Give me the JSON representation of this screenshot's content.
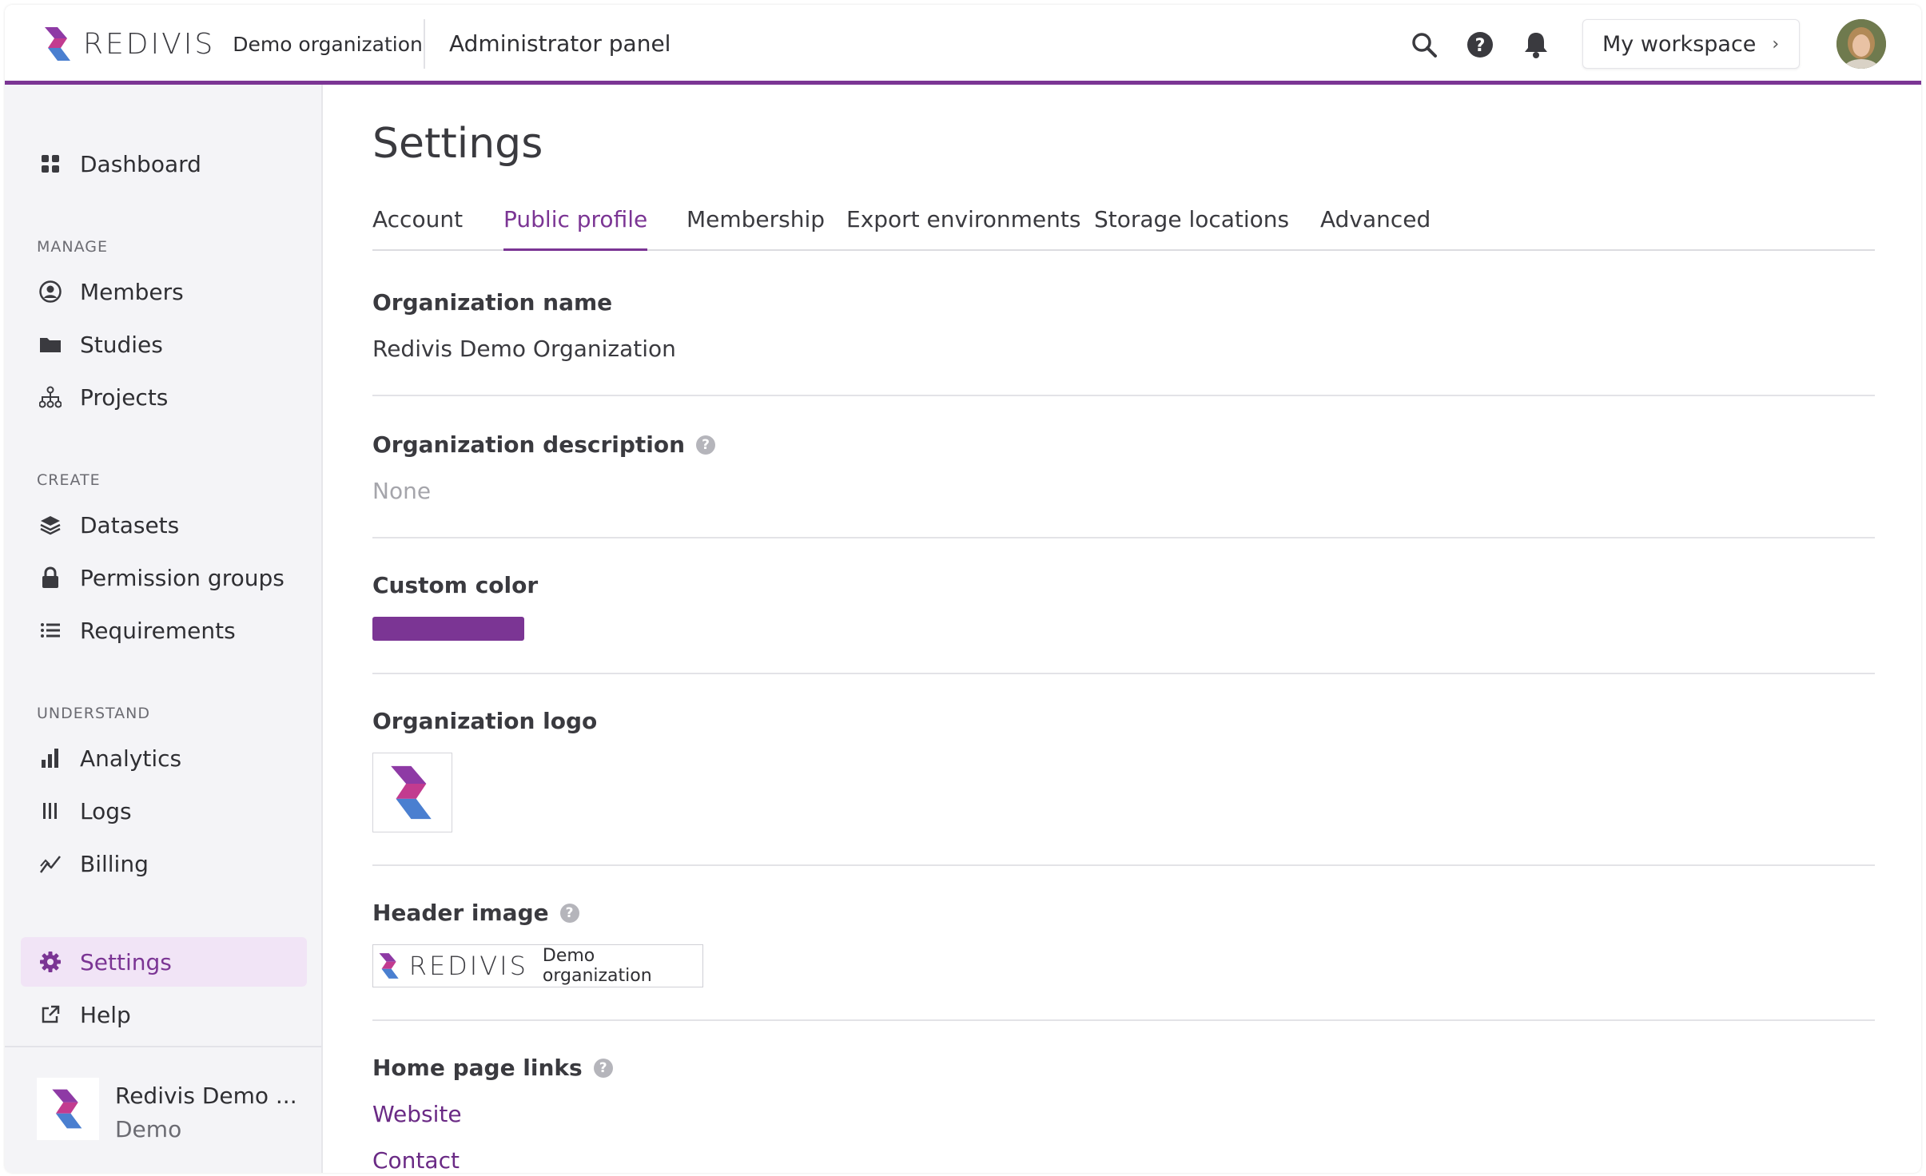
{
  "header": {
    "brand": "REDIVIS",
    "org_label": "Demo organization",
    "panel_title": "Administrator panel",
    "workspace_button": "My workspace"
  },
  "sidebar": {
    "dashboard": "Dashboard",
    "manage_heading": "MANAGE",
    "manage_items": [
      "Members",
      "Studies",
      "Projects"
    ],
    "create_heading": "CREATE",
    "create_items": [
      "Datasets",
      "Permission groups",
      "Requirements"
    ],
    "understand_heading": "UNDERSTAND",
    "understand_items": [
      "Analytics",
      "Logs",
      "Billing"
    ],
    "settings": "Settings",
    "help": "Help",
    "org_name": "Redivis Demo ...",
    "org_sub": "Demo"
  },
  "main": {
    "title": "Settings",
    "tabs": [
      "Account",
      "Public profile",
      "Membership",
      "Export environments",
      "Storage locations",
      "Advanced"
    ],
    "active_tab": "Public profile",
    "org_name_label": "Organization name",
    "org_name_value": "Redivis Demo Organization",
    "org_desc_label": "Organization description",
    "org_desc_value": "None",
    "custom_color_label": "Custom color",
    "custom_color_value": "#7b3594",
    "org_logo_label": "Organization logo",
    "header_image_label": "Header image",
    "header_image_brand": "REDIVIS",
    "header_image_org": "Demo organization",
    "home_links_label": "Home page links",
    "home_links": [
      "Website",
      "Contact"
    ]
  },
  "colors": {
    "accent": "#7b3594",
    "active_bg": "#f1e4f6",
    "link": "#6a2a85"
  }
}
